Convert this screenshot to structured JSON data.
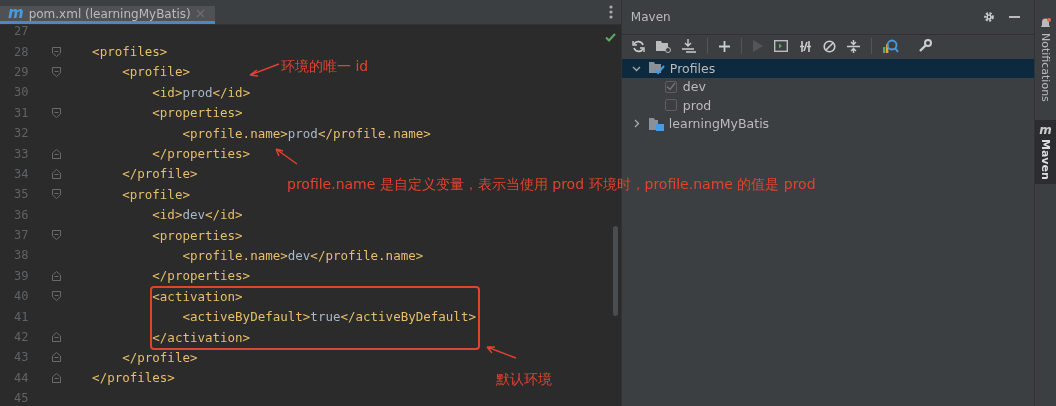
{
  "editor_tab": {
    "icon_text": "m",
    "title": "pom.xml (learningMyBatis)",
    "selected": true
  },
  "editor": {
    "lines": [
      {
        "number": "27",
        "fold_start": false,
        "fold_end": false
      },
      {
        "number": "28",
        "fold_start": true,
        "fold_end": false,
        "tokens": [
          {
            "kind": "tag",
            "text": "    <profiles>"
          }
        ]
      },
      {
        "number": "29",
        "fold_start": true,
        "fold_end": false,
        "tokens": [
          {
            "kind": "tag",
            "text": "        <profile>"
          }
        ]
      },
      {
        "number": "30",
        "fold_start": false,
        "fold_end": false,
        "tokens": [
          {
            "kind": "tag",
            "text": "            <id>"
          },
          {
            "kind": "value",
            "text": "prod"
          },
          {
            "kind": "tag",
            "text": "</id>"
          }
        ]
      },
      {
        "number": "31",
        "fold_start": true,
        "fold_end": false,
        "tokens": [
          {
            "kind": "tag",
            "text": "            <properties>"
          }
        ]
      },
      {
        "number": "32",
        "fold_start": false,
        "fold_end": false,
        "tokens": [
          {
            "kind": "tag",
            "text": "                <profile.name>"
          },
          {
            "kind": "value",
            "text": "prod"
          },
          {
            "kind": "tag",
            "text": "</profile.name>"
          }
        ]
      },
      {
        "number": "33",
        "fold_start": false,
        "fold_end": true,
        "tokens": [
          {
            "kind": "tag",
            "text": "            </properties>"
          }
        ]
      },
      {
        "number": "34",
        "fold_start": false,
        "fold_end": true,
        "tokens": [
          {
            "kind": "tag",
            "text": "        </profile>"
          }
        ]
      },
      {
        "number": "35",
        "fold_start": true,
        "fold_end": false,
        "tokens": [
          {
            "kind": "tag",
            "text": "        <profile>"
          }
        ]
      },
      {
        "number": "36",
        "fold_start": false,
        "fold_end": false,
        "tokens": [
          {
            "kind": "tag",
            "text": "            <id>"
          },
          {
            "kind": "value",
            "text": "dev"
          },
          {
            "kind": "tag",
            "text": "</id>"
          }
        ]
      },
      {
        "number": "37",
        "fold_start": true,
        "fold_end": false,
        "tokens": [
          {
            "kind": "tag",
            "text": "            <properties>"
          }
        ]
      },
      {
        "number": "38",
        "fold_start": false,
        "fold_end": false,
        "tokens": [
          {
            "kind": "tag",
            "text": "                <profile.name>"
          },
          {
            "kind": "value",
            "text": "dev"
          },
          {
            "kind": "tag",
            "text": "</profile.name>"
          }
        ]
      },
      {
        "number": "39",
        "fold_start": false,
        "fold_end": true,
        "tokens": [
          {
            "kind": "tag",
            "text": "            </properties>"
          }
        ]
      },
      {
        "number": "40",
        "fold_start": true,
        "fold_end": false,
        "tokens": [
          {
            "kind": "tag",
            "text": "            <activation>"
          }
        ]
      },
      {
        "number": "41",
        "fold_start": false,
        "fold_end": false,
        "tokens": [
          {
            "kind": "tag",
            "text": "                <activeByDefault>"
          },
          {
            "kind": "value",
            "text": "true"
          },
          {
            "kind": "tag",
            "text": "</activeByDefault>"
          }
        ]
      },
      {
        "number": "42",
        "fold_start": false,
        "fold_end": true,
        "tokens": [
          {
            "kind": "tag",
            "text": "            </activation>"
          }
        ]
      },
      {
        "number": "43",
        "fold_start": false,
        "fold_end": true,
        "tokens": [
          {
            "kind": "tag",
            "text": "        </profile>"
          }
        ]
      },
      {
        "number": "44",
        "fold_start": false,
        "fold_end": true,
        "tokens": [
          {
            "kind": "tag",
            "text": "    </profiles>"
          }
        ]
      },
      {
        "number": "45",
        "fold_start": false,
        "fold_end": false
      }
    ]
  },
  "annotations": [
    {
      "kind": "note",
      "text": "环境的唯一 id"
    },
    {
      "kind": "note",
      "text": "profile.name 是自定义变量，表示当使用 prod 环境时，profile.name 的值是 prod"
    },
    {
      "kind": "note",
      "text": "默认环境"
    }
  ],
  "maven": {
    "title": "Maven",
    "tree": [
      {
        "label": "Profiles",
        "selected": true,
        "expanded": true,
        "children": [
          {
            "label": "dev",
            "checked": true
          },
          {
            "label": "prod",
            "checked": false
          }
        ]
      },
      {
        "label": "learningMyBatis",
        "selected": false,
        "expanded": false
      }
    ]
  },
  "side_stripe": [
    {
      "label": "Notifications",
      "selected": false
    },
    {
      "icon_text": "m",
      "label": "Maven",
      "selected": true
    }
  ]
}
